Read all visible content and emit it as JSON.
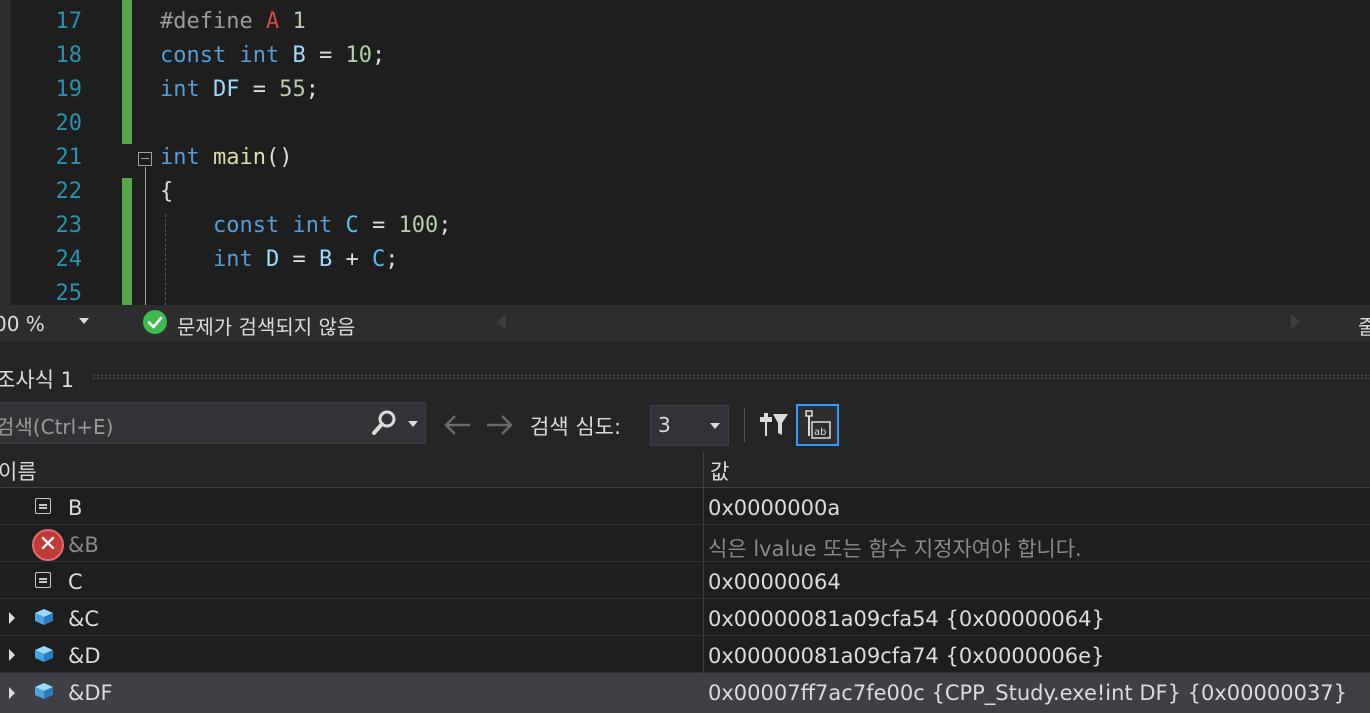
{
  "editor": {
    "lines": [
      {
        "num": "17"
      },
      {
        "num": "18"
      },
      {
        "num": "19"
      },
      {
        "num": "20"
      },
      {
        "num": "21"
      },
      {
        "num": "22"
      },
      {
        "num": "23"
      },
      {
        "num": "24"
      },
      {
        "num": "25"
      }
    ],
    "code": {
      "l17": {
        "define": "#define",
        "macro": "A",
        "value": "1"
      },
      "l18": {
        "const": "const",
        "int": "int",
        "name": "B",
        "eq": "=",
        "value": "10",
        "semi": ";"
      },
      "l19": {
        "int": "int",
        "name": "DF",
        "eq": "=",
        "value": "55",
        "semi": ";"
      },
      "l21": {
        "int": "int",
        "fn": "main",
        "parens": "()"
      },
      "l22": {
        "brace": "{"
      },
      "l23": {
        "const": "const",
        "int": "int",
        "name": "C",
        "eq": "=",
        "value": "100",
        "semi": ";"
      },
      "l24": {
        "int": "int",
        "name": "D",
        "eq": "=",
        "b": "B",
        "plus": "+",
        "c": "C",
        "semi": ";"
      }
    }
  },
  "status": {
    "zoom": "00 %",
    "message": "문제가 검색되지 않음",
    "right_cut": "줄"
  },
  "watch": {
    "title": "조사식 1",
    "search_placeholder": "검색(Ctrl+E)",
    "depth_label": "검색 심도:",
    "depth_value": "3",
    "columns": {
      "name": "이름",
      "value": "값"
    },
    "rows": [
      {
        "name": "B",
        "value": "0x0000000a",
        "icon": "field-icon",
        "expandable": false
      },
      {
        "name": "&B",
        "value": "식은 lvalue 또는 함수 지정자여야 합니다.",
        "icon": "error-icon",
        "expandable": false
      },
      {
        "name": "C",
        "value": "0x00000064",
        "icon": "field-icon",
        "expandable": false
      },
      {
        "name": "&C",
        "value": "0x00000081a09cfa54 {0x00000064}",
        "icon": "object-icon",
        "expandable": true
      },
      {
        "name": "&D",
        "value": "0x00000081a09cfa74 {0x0000006e}",
        "icon": "object-icon",
        "expandable": true
      },
      {
        "name": "&DF",
        "value": "0x00007ff7ac7fe00c {CPP_Study.exe!int DF} {0x00000037}",
        "icon": "object-icon",
        "expandable": true,
        "selected": true
      }
    ]
  },
  "colors": {
    "keyword": "#569cd6",
    "number": "#b5cea8",
    "function": "#dcdcaa",
    "macro": "#d64a4a",
    "line_number": "#2b91af",
    "change_bar": "#57a64a",
    "error": "#c23b3b",
    "focus": "#3399ff"
  }
}
